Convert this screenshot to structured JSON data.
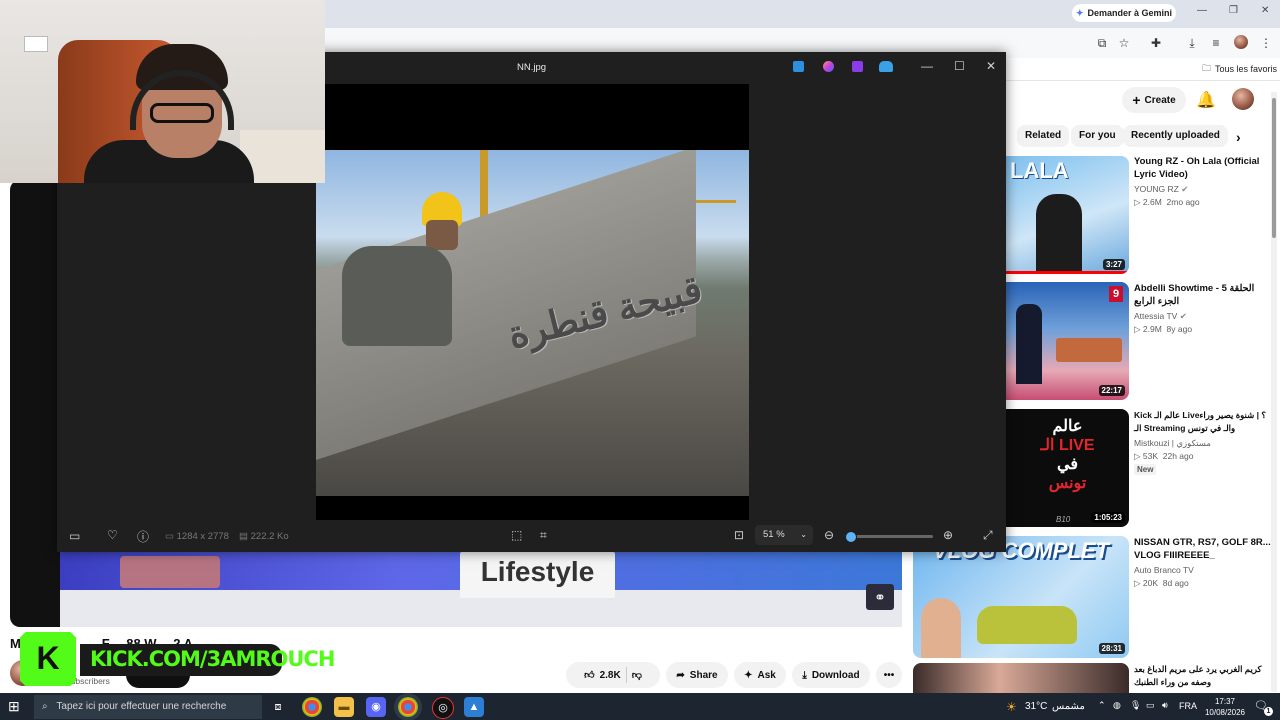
{
  "browser": {
    "gemini_label": "Demander à Gemini",
    "bookmarks_label": "Tous les favoris"
  },
  "youtube": {
    "create_label": "Create",
    "chips": [
      "Related",
      "For you",
      "Recently uploaded"
    ],
    "video_sign_text": "Lifestyle",
    "title_partial": "Ma",
    "title_tail": "F… 88 W… 2 A",
    "subscribers_label": "Subscribers",
    "actions": {
      "likes": "2.8K",
      "share": "Share",
      "ask": "Ask",
      "download": "Download"
    },
    "recommendations": [
      {
        "title": "Young RZ - Oh Lala (Official Lyric Video)",
        "channel": "YOUNG RZ",
        "verified": true,
        "views": "2.6M",
        "age": "2mo ago",
        "duration": "3:27",
        "thumb_text": "LALA"
      },
      {
        "title": "Abdelli Showtime - الحلقة 5 الجزء الرابع",
        "channel": "Attessia TV",
        "verified": true,
        "views": "2.9M",
        "age": "8y ago",
        "duration": "22:17",
        "thumb_text": "9"
      },
      {
        "title": "Kick عالم الـ Live؟ | شنوة يصير وراء الـ Streaming والـ في تونس",
        "channel": "Mistkouzi | مستكوزي",
        "verified": false,
        "views": "53K",
        "age": "22h ago",
        "badge": "New",
        "duration": "1:05:23",
        "thumb_text_lines": [
          "عالم",
          "الـ LIVE",
          "في",
          "تونس"
        ],
        "thumb_corner": "B10"
      },
      {
        "title": "NISSAN GTR, RS7, GOLF 8R... VLOG FIIIREEEE_",
        "channel": "Auto Branco TV",
        "verified": false,
        "views": "20K",
        "age": "8d ago",
        "duration": "28:31",
        "thumb_text": "VLOG COMPLET"
      },
      {
        "title": "كريم الغربي يرد على مريم الدباغ بعد وصفه من وراء الطنبك",
        "channel": "",
        "verified": false
      }
    ]
  },
  "viewer": {
    "filename": "NN.jpg",
    "dimensions": "1284 x 2778",
    "filesize": "222.2 Ko",
    "zoom": "51 %",
    "zoom_level": 0.06,
    "image_text": "قبيحة قنطرة"
  },
  "overlay": {
    "kick_text": "KICK.COM/3AMROUCH",
    "kick_letter": "K"
  },
  "taskbar": {
    "search_placeholder": "Tapez ici pour effectuer une recherche",
    "weather": "31°C",
    "weather_label": "مشمس",
    "language": "FRA",
    "time": "17:37",
    "date": "10/08/2026",
    "notifications": "1"
  },
  "colors": {
    "kick_green": "#53fc18",
    "taskbar": "#1c2530",
    "viewer_bg": "#1f1f1f"
  }
}
